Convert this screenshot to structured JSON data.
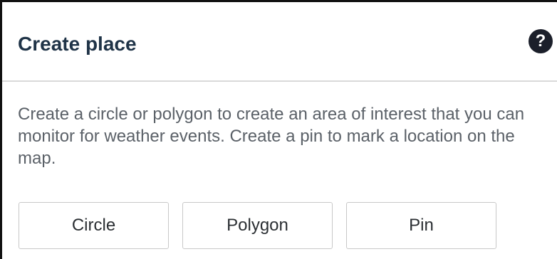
{
  "panel": {
    "title": "Create place",
    "help_icon": "question-mark-icon",
    "help_glyph": "?",
    "description": "Create a circle or polygon to create an area of interest that you can monitor for weather events. Create a pin to mark a location on the map.",
    "buttons": {
      "circle": "Circle",
      "polygon": "Polygon",
      "pin": "Pin"
    }
  },
  "colors": {
    "title": "#1f3347",
    "text": "#5b6168",
    "border": "#111111",
    "divider": "#d9d9d9"
  }
}
